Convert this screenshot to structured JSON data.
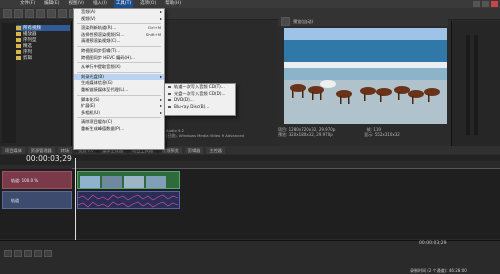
{
  "menubar": {
    "items": [
      "文件(F)",
      "编辑(E)",
      "视图(V)",
      "插入(I)",
      "工具(T)",
      "选项(O)",
      "帮助(H)"
    ],
    "active_index": 4
  },
  "explorer": {
    "folders": [
      "所有视频",
      "播放器",
      "序列型",
      "精选",
      "序列",
      "剪辑"
    ]
  },
  "tools_menu": {
    "items": [
      {
        "label": "音频(A)",
        "shortcut": "",
        "arrow": true
      },
      {
        "label": "视频(V)",
        "shortcut": "",
        "arrow": true
      },
      {
        "sep": true
      },
      {
        "label": "渲染到新轨道(R)...",
        "shortcut": "Ctrl+M"
      },
      {
        "label": "选择性预渲染视频(S)...",
        "shortcut": "Shift+M"
      },
      {
        "label": "清理预渲染视频(C)...",
        "shortcut": ""
      },
      {
        "sep": true
      },
      {
        "label": "跨视图同步剪辑(T)...",
        "shortcut": ""
      },
      {
        "label": "跨视图同步 HEVC 编码(H)...",
        "shortcut": ""
      },
      {
        "sep": true
      },
      {
        "label": "从单行中提取音频(X)",
        "shortcut": ""
      },
      {
        "sep": true
      },
      {
        "label": "刻录光盘(B)",
        "shortcut": "",
        "arrow": true,
        "highlight": true
      },
      {
        "label": "生成媒体信息(G)",
        "shortcut": ""
      },
      {
        "label": "重新链接媒体至代理(L)...",
        "shortcut": ""
      },
      {
        "sep": true
      },
      {
        "label": "脚本化(S)",
        "shortcut": "",
        "arrow": true
      },
      {
        "label": "扩展(E)",
        "shortcut": "",
        "arrow": true
      },
      {
        "label": "多相机(U)",
        "shortcut": "",
        "arrow": true
      },
      {
        "sep": true
      },
      {
        "label": "清除项目缓存(C)",
        "shortcut": ""
      },
      {
        "label": "重新生成峰值数据(P)...",
        "shortcut": ""
      }
    ]
  },
  "burn_submenu": {
    "items": [
      "轨道一次写入音频 CD(T)...",
      "光盘一次写入音频 CD(D)...",
      "DVD(D)...",
      "Blu-ray Disc(B)..."
    ]
  },
  "properties": {
    "lines": [
      "Audio 9.2",
      "(已创), Windows Media Video 9 Advanced"
    ]
  },
  "preview": {
    "header": [
      "预览(自动)"
    ],
    "project_label": "项目:",
    "project_value": "1280x720x32, 29.970p",
    "preview_label": "预览:",
    "preview_value": "320x180x32, 29.970p",
    "frame_label": "帧:",
    "frame_value": "119",
    "display_label": "显示:",
    "display_value": "552x310x32"
  },
  "tabs": [
    "项目媒体",
    "资源管理器",
    "转场",
    "视频 FX",
    "媒体生成器",
    "项目工具箱",
    "视频预览",
    "剪辑器",
    "主控器"
  ],
  "timeline": {
    "timecode": "00:00:03;29",
    "track1_label": "轨道: 100.0 %",
    "track2_label": "轨道",
    "bottom_time": "00:00:03;29",
    "record_time": "录制时间 (2 个通道): 46:28:00"
  }
}
